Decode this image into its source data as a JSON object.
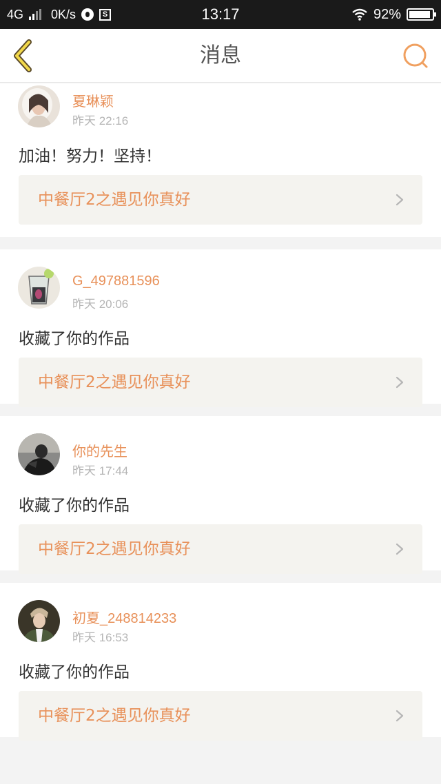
{
  "status_bar": {
    "network": "4G",
    "speed": "0K/s",
    "time": "13:17",
    "battery": "92%"
  },
  "nav": {
    "title": "消息",
    "back_icon": "chevron-left-icon",
    "search_icon": "search-icon",
    "accent": "#f0a060"
  },
  "notifications": [
    {
      "username": "夏琳颖",
      "time": "昨天 22:16",
      "message": "加油！努力！坚持！",
      "work_title": "中餐厅2之遇见你真好"
    },
    {
      "username": "G_497881596",
      "time": "昨天 20:06",
      "message": "收藏了你的作品",
      "work_title": "中餐厅2之遇见你真好"
    },
    {
      "username": "你的先生",
      "time": "昨天 17:44",
      "message": "收藏了你的作品",
      "work_title": "中餐厅2之遇见你真好"
    },
    {
      "username": "初夏_248814233",
      "time": "昨天 16:53",
      "message": "收藏了你的作品",
      "work_title": "中餐厅2之遇见你真好"
    }
  ],
  "colors": {
    "username": "#e8915a",
    "link_bg": "#f4f3ef",
    "status_bar_bg": "#1a1a1a"
  }
}
